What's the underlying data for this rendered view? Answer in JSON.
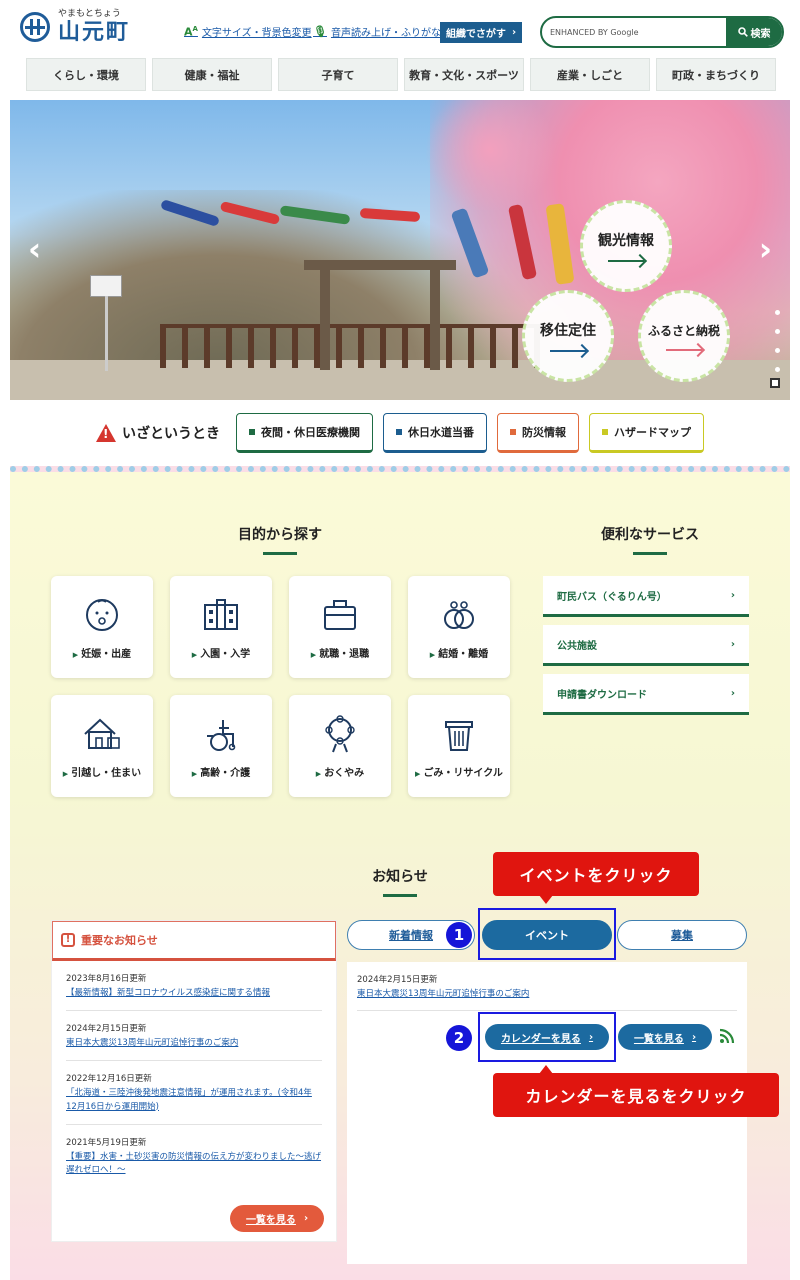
{
  "header": {
    "logo_kana": "やまもとちょう",
    "logo_name": "山元町",
    "util_text_size": "文字サイズ・背景色変更",
    "util_voice": "音声読み上げ・ふりがな",
    "org_search": "組織でさがす",
    "search_placeholder": "ENHANCED BY Google",
    "search_button": "検索"
  },
  "gnav": [
    "くらし・環境",
    "健康・福祉",
    "子育て",
    "教育・文化・スポーツ",
    "産業・しごと",
    "町政・まちづくり"
  ],
  "hero": {
    "bubbles": [
      "観光情報",
      "移住定住",
      "ふるさと納税"
    ]
  },
  "emergency": {
    "title": "いざというとき",
    "buttons": [
      {
        "label": "夜間・休日医療機関",
        "color": "#1e6b43"
      },
      {
        "label": "休日水道当番",
        "color": "#1c5d8f"
      },
      {
        "label": "防災情報",
        "color": "#e06a3c"
      },
      {
        "label": "ハザードマップ",
        "color": "#c9c923"
      }
    ]
  },
  "purpose": {
    "title": "目的から探す",
    "items": [
      "妊娠・出産",
      "入園・入学",
      "就職・退職",
      "結婚・離婚",
      "引越し・住まい",
      "高齢・介護",
      "おくやみ",
      "ごみ・リサイクル"
    ]
  },
  "services": {
    "title": "便利なサービス",
    "items": [
      "町民バス（ぐるりん号）",
      "公共施設",
      "申請書ダウンロード"
    ]
  },
  "news": {
    "title": "お知らせ",
    "important_title": "重要なお知らせ",
    "important_items": [
      {
        "date": "2023年8月16日更新",
        "text": "【最新情報】新型コロナウイルス感染症に関する情報"
      },
      {
        "date": "2024年2月15日更新",
        "text": "東日本大震災13周年山元町追悼行事のご案内"
      },
      {
        "date": "2022年12月16日更新",
        "text": "「北海道・三陸沖後発地震注意情報」が運用されます。(令和4年12月16日から運用開始)"
      },
      {
        "date": "2021年5月19日更新",
        "text": "【重要】水害・土砂災害の防災情報の伝え方が変わりました～逃げ遅れゼロへ！～"
      }
    ],
    "list_button": "一覧を見る",
    "tabs": [
      "新着情報",
      "イベント",
      "募集"
    ],
    "event_date": "2024年2月15日更新",
    "event_text": "東日本大震災13周年山元町追悼行事のご案内",
    "calendar_button": "カレンダーを見る",
    "event_list_button": "一覧を見る"
  },
  "annotations": {
    "callout1": "イベントをクリック",
    "callout2": "カレンダーを見るをクリック",
    "step1": "1",
    "step2": "2"
  }
}
